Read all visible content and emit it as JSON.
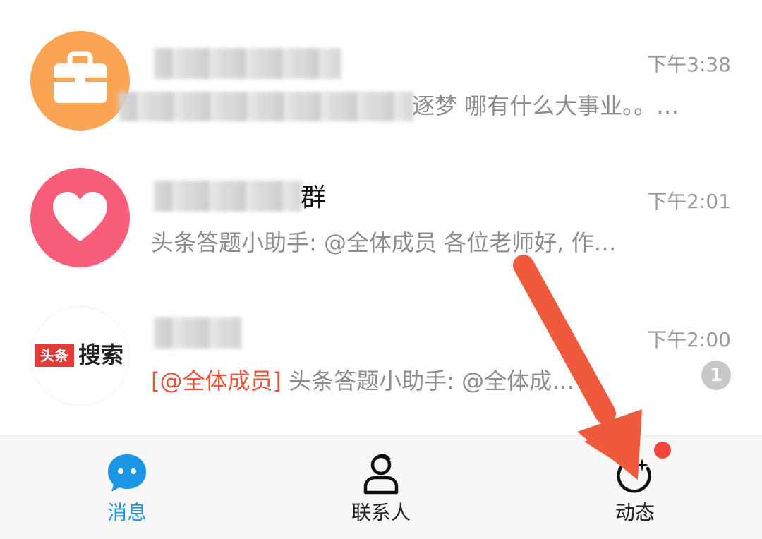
{
  "chats": [
    {
      "name_visible": "",
      "preview_visible": "逐梦 哪有什么大事业。。…",
      "time": "下午3:38",
      "avatar_icon": "briefcase-icon",
      "avatar_color": "#fba554"
    },
    {
      "name_visible": "群",
      "preview": "头条答题小助手: @全体成员 各位老师好, 作…",
      "time": "下午2:01",
      "avatar_icon": "heart-icon",
      "avatar_color": "#f85e7a"
    },
    {
      "name_visible": "",
      "mention_tag": "[@全体成员]",
      "preview": " 头条答题小助手: @全体成…",
      "time": "下午2:00",
      "avatar_logo_tag": "头条",
      "avatar_logo_text": "搜索",
      "unread": "1"
    }
  ],
  "tabbar": {
    "tabs": [
      {
        "label": "消息",
        "icon": "chat-bubble-icon",
        "active": true
      },
      {
        "label": "联系人",
        "icon": "contact-person-icon",
        "active": false
      },
      {
        "label": "动态",
        "icon": "moments-icon",
        "active": false,
        "has_dot": true
      }
    ]
  },
  "colors": {
    "accent": "#1c97e6",
    "mention": "#e8533a",
    "arrow": "#f05a3c",
    "notification_dot": "#f2473a"
  },
  "overlay": {
    "icon": "red-arrow-annotation-icon"
  }
}
